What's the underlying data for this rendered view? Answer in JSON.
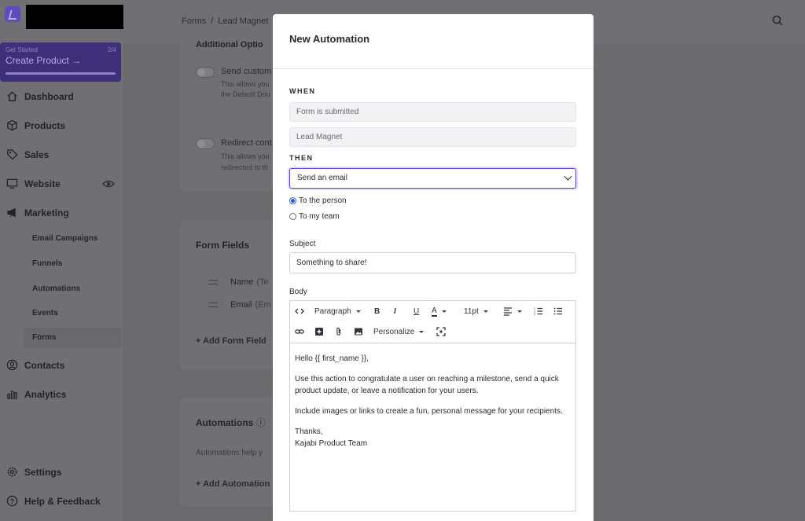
{
  "topbar": {
    "breadcrumb": [
      "Forms",
      "Lead Magnet"
    ]
  },
  "sidebar": {
    "promo": {
      "kicker": "Get Started",
      "step": "2/4",
      "title": "Create Product",
      "progress": 1.0
    },
    "items": [
      {
        "label": "Dashboard",
        "icon": "home-icon"
      },
      {
        "label": "Products",
        "icon": "box-icon"
      },
      {
        "label": "Sales",
        "icon": "tag-icon"
      },
      {
        "label": "Website",
        "icon": "monitor-icon"
      },
      {
        "label": "Marketing",
        "icon": "megaphone-icon"
      },
      {
        "label": "Contacts",
        "icon": "user-circle-icon"
      },
      {
        "label": "Analytics",
        "icon": "bar-chart-icon"
      }
    ],
    "marketing_sub": [
      "Email Campaigns",
      "Funnels",
      "Automations",
      "Events",
      "Forms"
    ],
    "bottom": [
      {
        "label": "Settings",
        "icon": "gear-icon"
      },
      {
        "label": "Help & Feedback",
        "icon": "help-icon"
      }
    ]
  },
  "background": {
    "additional_options_title": "Additional Optio",
    "opt1_title": "Send custom",
    "opt1_desc": [
      "This allows you",
      "the Default Dou"
    ],
    "opt2_title": "Redirect cont",
    "opt2_desc": [
      "This allows you",
      "redirected to th"
    ],
    "form_fields_title": "Form Fields",
    "fields": [
      {
        "label": "Name",
        "type": "(Te"
      },
      {
        "label": "Email",
        "type": "(Em"
      }
    ],
    "add_form_field": "Add Form Field",
    "automations_title": "Automations",
    "automations_desc": "Automations help y",
    "add_automation": "Add Automation"
  },
  "modal": {
    "title": "New Automation",
    "when_label": "WHEN",
    "trigger": "Form is submitted",
    "trigger_target": "Lead Magnet",
    "then_label": "THEN",
    "action": "Send an email",
    "recipients": [
      {
        "label": "To the person",
        "selected": true
      },
      {
        "label": "To my team",
        "selected": false
      }
    ],
    "subject_label": "Subject",
    "subject_value": "Something to share!",
    "body_label": "Body",
    "toolbar": {
      "paragraph": "Paragraph",
      "font_size": "11pt",
      "personalize": "Personalize"
    },
    "body": {
      "greeting": "Hello {{ first_name }},",
      "p1": "Use this action to congratulate a user on reaching a milestone, send a quick product update, or leave a notification for your users.",
      "p2": "Include images or links to create a fun, personal message for your recipients.",
      "signoff": "Thanks,",
      "team": "Kajabi Product Team"
    },
    "accent_color": "#5b3fd6"
  }
}
